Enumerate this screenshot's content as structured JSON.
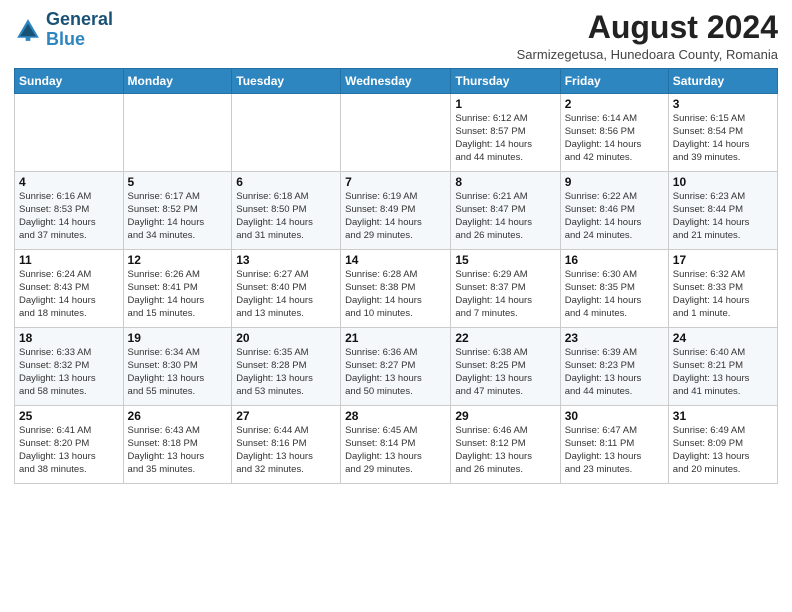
{
  "logo": {
    "line1": "General",
    "line2": "Blue"
  },
  "title": "August 2024",
  "subtitle": "Sarmizegetusa, Hunedoara County, Romania",
  "days_of_week": [
    "Sunday",
    "Monday",
    "Tuesday",
    "Wednesday",
    "Thursday",
    "Friday",
    "Saturday"
  ],
  "weeks": [
    [
      {
        "day": "",
        "info": ""
      },
      {
        "day": "",
        "info": ""
      },
      {
        "day": "",
        "info": ""
      },
      {
        "day": "",
        "info": ""
      },
      {
        "day": "1",
        "info": "Sunrise: 6:12 AM\nSunset: 8:57 PM\nDaylight: 14 hours\nand 44 minutes."
      },
      {
        "day": "2",
        "info": "Sunrise: 6:14 AM\nSunset: 8:56 PM\nDaylight: 14 hours\nand 42 minutes."
      },
      {
        "day": "3",
        "info": "Sunrise: 6:15 AM\nSunset: 8:54 PM\nDaylight: 14 hours\nand 39 minutes."
      }
    ],
    [
      {
        "day": "4",
        "info": "Sunrise: 6:16 AM\nSunset: 8:53 PM\nDaylight: 14 hours\nand 37 minutes."
      },
      {
        "day": "5",
        "info": "Sunrise: 6:17 AM\nSunset: 8:52 PM\nDaylight: 14 hours\nand 34 minutes."
      },
      {
        "day": "6",
        "info": "Sunrise: 6:18 AM\nSunset: 8:50 PM\nDaylight: 14 hours\nand 31 minutes."
      },
      {
        "day": "7",
        "info": "Sunrise: 6:19 AM\nSunset: 8:49 PM\nDaylight: 14 hours\nand 29 minutes."
      },
      {
        "day": "8",
        "info": "Sunrise: 6:21 AM\nSunset: 8:47 PM\nDaylight: 14 hours\nand 26 minutes."
      },
      {
        "day": "9",
        "info": "Sunrise: 6:22 AM\nSunset: 8:46 PM\nDaylight: 14 hours\nand 24 minutes."
      },
      {
        "day": "10",
        "info": "Sunrise: 6:23 AM\nSunset: 8:44 PM\nDaylight: 14 hours\nand 21 minutes."
      }
    ],
    [
      {
        "day": "11",
        "info": "Sunrise: 6:24 AM\nSunset: 8:43 PM\nDaylight: 14 hours\nand 18 minutes."
      },
      {
        "day": "12",
        "info": "Sunrise: 6:26 AM\nSunset: 8:41 PM\nDaylight: 14 hours\nand 15 minutes."
      },
      {
        "day": "13",
        "info": "Sunrise: 6:27 AM\nSunset: 8:40 PM\nDaylight: 14 hours\nand 13 minutes."
      },
      {
        "day": "14",
        "info": "Sunrise: 6:28 AM\nSunset: 8:38 PM\nDaylight: 14 hours\nand 10 minutes."
      },
      {
        "day": "15",
        "info": "Sunrise: 6:29 AM\nSunset: 8:37 PM\nDaylight: 14 hours\nand 7 minutes."
      },
      {
        "day": "16",
        "info": "Sunrise: 6:30 AM\nSunset: 8:35 PM\nDaylight: 14 hours\nand 4 minutes."
      },
      {
        "day": "17",
        "info": "Sunrise: 6:32 AM\nSunset: 8:33 PM\nDaylight: 14 hours\nand 1 minute."
      }
    ],
    [
      {
        "day": "18",
        "info": "Sunrise: 6:33 AM\nSunset: 8:32 PM\nDaylight: 13 hours\nand 58 minutes."
      },
      {
        "day": "19",
        "info": "Sunrise: 6:34 AM\nSunset: 8:30 PM\nDaylight: 13 hours\nand 55 minutes."
      },
      {
        "day": "20",
        "info": "Sunrise: 6:35 AM\nSunset: 8:28 PM\nDaylight: 13 hours\nand 53 minutes."
      },
      {
        "day": "21",
        "info": "Sunrise: 6:36 AM\nSunset: 8:27 PM\nDaylight: 13 hours\nand 50 minutes."
      },
      {
        "day": "22",
        "info": "Sunrise: 6:38 AM\nSunset: 8:25 PM\nDaylight: 13 hours\nand 47 minutes."
      },
      {
        "day": "23",
        "info": "Sunrise: 6:39 AM\nSunset: 8:23 PM\nDaylight: 13 hours\nand 44 minutes."
      },
      {
        "day": "24",
        "info": "Sunrise: 6:40 AM\nSunset: 8:21 PM\nDaylight: 13 hours\nand 41 minutes."
      }
    ],
    [
      {
        "day": "25",
        "info": "Sunrise: 6:41 AM\nSunset: 8:20 PM\nDaylight: 13 hours\nand 38 minutes."
      },
      {
        "day": "26",
        "info": "Sunrise: 6:43 AM\nSunset: 8:18 PM\nDaylight: 13 hours\nand 35 minutes."
      },
      {
        "day": "27",
        "info": "Sunrise: 6:44 AM\nSunset: 8:16 PM\nDaylight: 13 hours\nand 32 minutes."
      },
      {
        "day": "28",
        "info": "Sunrise: 6:45 AM\nSunset: 8:14 PM\nDaylight: 13 hours\nand 29 minutes."
      },
      {
        "day": "29",
        "info": "Sunrise: 6:46 AM\nSunset: 8:12 PM\nDaylight: 13 hours\nand 26 minutes."
      },
      {
        "day": "30",
        "info": "Sunrise: 6:47 AM\nSunset: 8:11 PM\nDaylight: 13 hours\nand 23 minutes."
      },
      {
        "day": "31",
        "info": "Sunrise: 6:49 AM\nSunset: 8:09 PM\nDaylight: 13 hours\nand 20 minutes."
      }
    ]
  ]
}
